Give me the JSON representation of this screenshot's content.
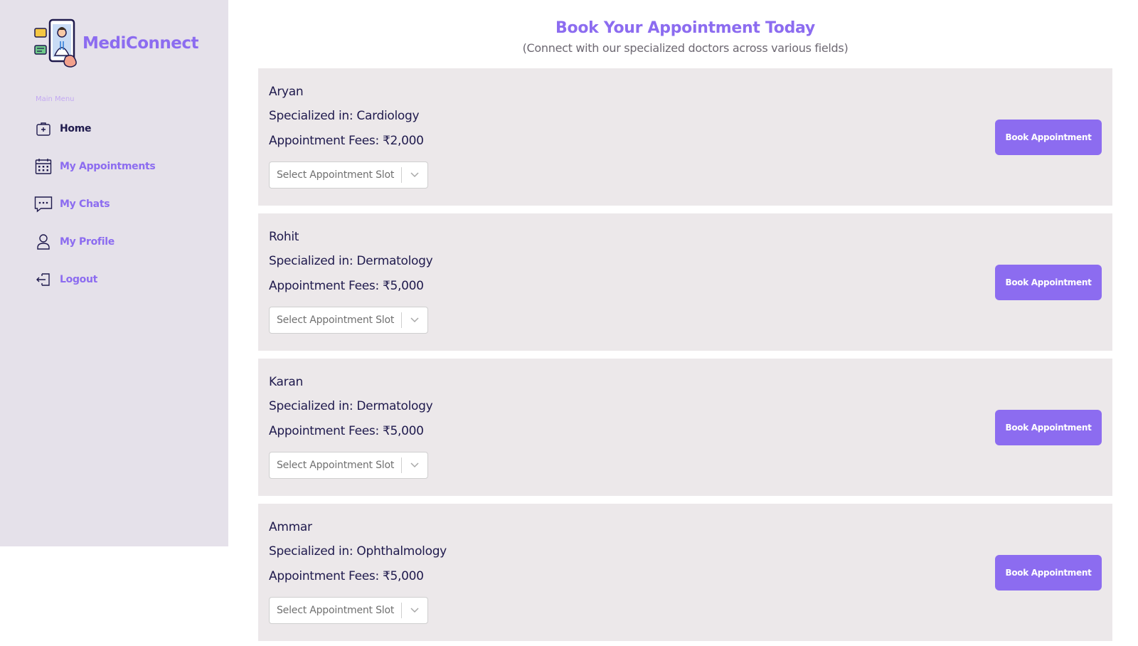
{
  "sidebar": {
    "brand": "MediConnect",
    "menu_heading": "Main Menu",
    "items": [
      {
        "label": "Home",
        "icon": "medical-bag-icon"
      },
      {
        "label": "My Appointments",
        "icon": "calendar-icon"
      },
      {
        "label": "My Chats",
        "icon": "chat-icon"
      },
      {
        "label": "My Profile",
        "icon": "user-icon"
      },
      {
        "label": "Logout",
        "icon": "logout-icon"
      }
    ]
  },
  "main": {
    "title": "Book Your Appointment Today",
    "subtitle": "(Connect with our specialized doctors across various fields)",
    "doctors": [
      {
        "name": "Aryan",
        "specialization": "Specialized in: Cardiology",
        "fees": "Appointment Fees: ₹2,000",
        "slot_placeholder": "Select Appointment Slot",
        "button": "Book Appointment"
      },
      {
        "name": "Rohit",
        "specialization": "Specialized in: Dermatology",
        "fees": "Appointment Fees: ₹5,000",
        "slot_placeholder": "Select Appointment Slot",
        "button": "Book Appointment"
      },
      {
        "name": "Karan",
        "specialization": "Specialized in: Dermatology",
        "fees": "Appointment Fees: ₹5,000",
        "slot_placeholder": "Select Appointment Slot",
        "button": "Book Appointment"
      },
      {
        "name": "Ammar",
        "specialization": "Specialized in: Ophthalmology",
        "fees": "Appointment Fees: ₹5,000",
        "slot_placeholder": "Select Appointment Slot",
        "button": "Book Appointment"
      }
    ]
  },
  "colors": {
    "accent": "#8c6cf0",
    "dark_text": "#1f1a4d",
    "sidebar_bg": "#e5e1ea",
    "card_bg": "#ece8ea"
  }
}
